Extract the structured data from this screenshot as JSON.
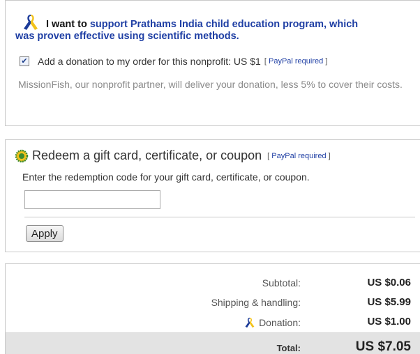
{
  "donation": {
    "intro": "I want to",
    "cause": "support Prathams India child education program, which",
    "cause_line2": "was proven effective using scientific methods.",
    "checkbox_checked": true,
    "checkbox_label": "Add a donation to my order for this nonprofit: US $1",
    "paypal_required": "PayPal required",
    "note": "MissionFish, our nonprofit partner, will deliver your donation, less 5% to cover their costs."
  },
  "gift": {
    "title": "Redeem a gift card, certificate, or coupon",
    "paypal_required": "PayPal required",
    "instructions": "Enter the redemption code for your gift card, certificate, or coupon.",
    "code_value": "",
    "apply_label": "Apply"
  },
  "summary": {
    "subtotal_label": "Subtotal:",
    "subtotal_value": "US $0.06",
    "shipping_label": "Shipping & handling:",
    "shipping_value": "US $5.99",
    "donation_label": "Donation:",
    "donation_value": "US $1.00",
    "total_label": "Total:",
    "total_value": "US $7.05"
  },
  "icons": {
    "ribbon": "awareness-ribbon-icon",
    "gift": "gift-card-badge-icon"
  },
  "colors": {
    "link_blue": "#1f3fa4",
    "total_bg": "#e3e3e3",
    "ribbon_blue": "#1d3c9a",
    "ribbon_yellow": "#f2c21b"
  }
}
